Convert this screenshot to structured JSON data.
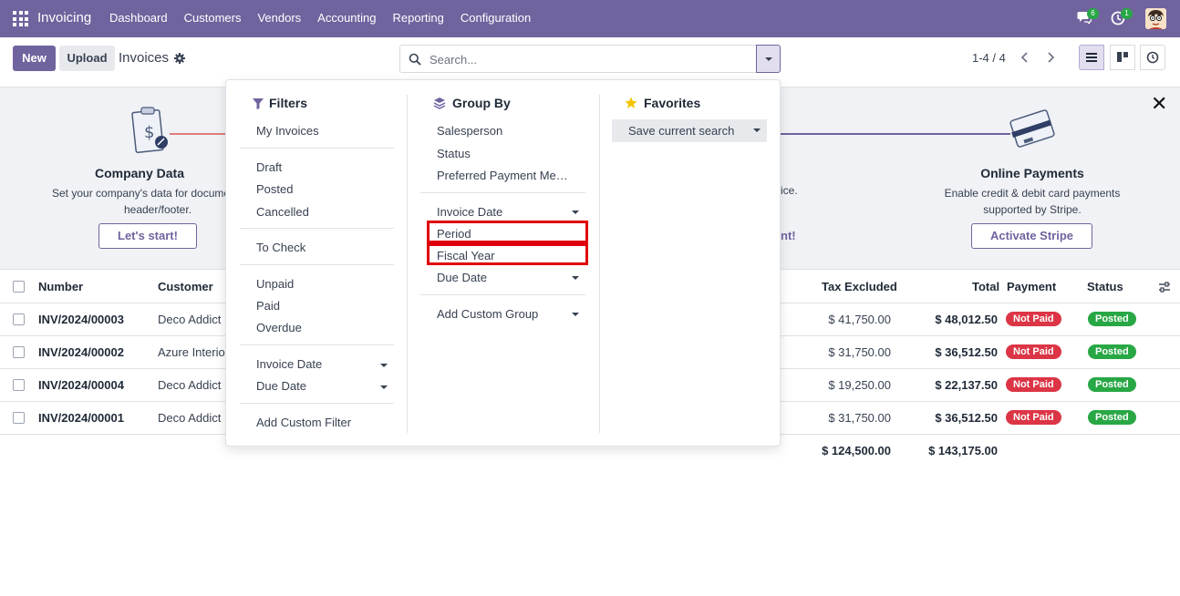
{
  "navbar": {
    "app_name": "Invoicing",
    "menu": [
      "Dashboard",
      "Customers",
      "Vendors",
      "Accounting",
      "Reporting",
      "Configuration"
    ],
    "chat_count": "6",
    "activity_count": "1",
    "bg_color": "#71639e"
  },
  "control": {
    "new_label": "New",
    "upload_label": "Upload",
    "title": "Invoices",
    "search_placeholder": "Search...",
    "pager": "1-4 / 4"
  },
  "banner": {
    "step1_title": "Company Data",
    "step1_desc_line1": "Set your company's data for docume",
    "step1_desc_line2": "header/footer.",
    "step1_button": "Let's start!",
    "step2_desc_fragment": "ice.",
    "step2_button_fragment": "nt!",
    "step3_title": "Online Payments",
    "step3_desc_line1": "Enable credit & debit card payments",
    "step3_desc_line2": "supported by Stripe.",
    "step3_button": "Activate Stripe"
  },
  "table": {
    "headers": {
      "number": "Number",
      "customer": "Customer",
      "tax_excluded": "Tax Excluded",
      "total": "Total",
      "payment": "Payment",
      "status": "Status"
    },
    "rows": [
      {
        "number": "INV/2024/00003",
        "customer": "Deco Addict",
        "tax_excluded": "$ 41,750.00",
        "total": "$ 48,012.50",
        "payment": "Not Paid",
        "status": "Posted"
      },
      {
        "number": "INV/2024/00002",
        "customer": "Azure Interio",
        "tax_excluded": "$ 31,750.00",
        "total": "$ 36,512.50",
        "payment": "Not Paid",
        "status": "Posted"
      },
      {
        "number": "INV/2024/00004",
        "customer": "Deco Addict",
        "tax_excluded": "$ 19,250.00",
        "total": "$ 22,137.50",
        "payment": "Not Paid",
        "status": "Posted"
      },
      {
        "number": "INV/2024/00001",
        "customer": "Deco Addict",
        "tax_excluded": "$ 31,750.00",
        "total": "$ 36,512.50",
        "payment": "Not Paid",
        "status": "Posted"
      }
    ],
    "footer": {
      "tax_excluded": "$ 124,500.00",
      "total": "$ 143,175.00"
    }
  },
  "dropdown": {
    "filters": {
      "title": "Filters",
      "items": [
        "My Invoices",
        "Draft",
        "Posted",
        "Cancelled",
        "To Check",
        "Unpaid",
        "Paid",
        "Overdue",
        "Invoice Date",
        "Due Date",
        "Add Custom Filter"
      ]
    },
    "group_by": {
      "title": "Group By",
      "items": [
        "Salesperson",
        "Status",
        "Preferred Payment Me…",
        "Invoice Date",
        "Period",
        "Fiscal Year",
        "Due Date",
        "Add Custom Group"
      ]
    },
    "favorites": {
      "title": "Favorites",
      "save_label": "Save current search"
    }
  },
  "colors": {
    "accent": "#71639e",
    "highlight": "#e0000b",
    "not_paid": "#dc3545",
    "posted": "#28a745"
  }
}
